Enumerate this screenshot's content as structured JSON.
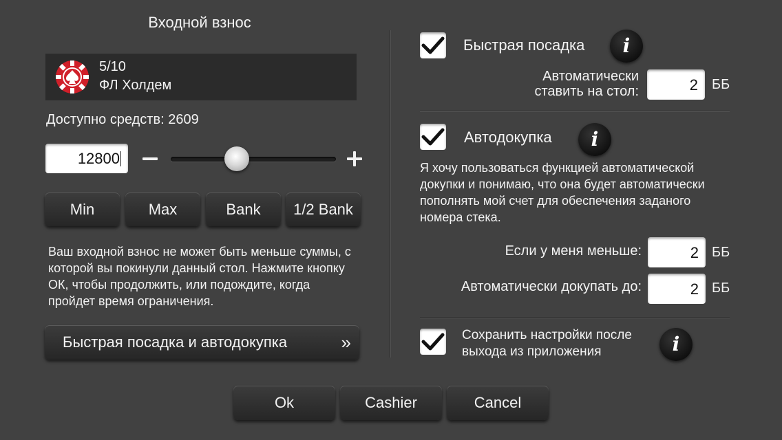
{
  "buyin": {
    "title": "Входной взнос",
    "table": {
      "stakes": "5/10",
      "game": "ФЛ Холдем"
    },
    "available_label": "Доступно средств: 2609",
    "amount_value": "12800",
    "minus_symbol": "−",
    "plus_symbol": "+",
    "slider_level": 0.4,
    "quick_buttons": [
      "Min",
      "Max",
      "Bank",
      "1/2 Bank"
    ],
    "notice": "Ваш входной взнос не может быть меньше суммы, с которой вы покинули данный стол. Нажмите кнопку ОК, чтобы продолжить, или подождите, когда пройдет время ограничения.",
    "fast_seat_button": "Быстрая посадка и автодокупка",
    "fast_seat_chevron": "»"
  },
  "settings": {
    "fast_seat": {
      "label": "Быстрая посадка",
      "checked": true,
      "auto_label_line1": "Автоматически",
      "auto_label_line2": "ставить на стол:",
      "value": "2",
      "unit": "ББ"
    },
    "auto_rebuy": {
      "label": "Автодокупка",
      "checked": true,
      "description": "Я хочу пользоваться функцией автоматической докупки и понимаю, что она будет автоматически пополнять мой счет для обеспечения заданого номера стека.",
      "if_less_label": "Если у меня меньше:",
      "if_less_value": "2",
      "rebuy_to_label": "Автоматически докупать до:",
      "rebuy_to_value": "2",
      "unit": "ББ"
    },
    "save_settings": {
      "label_line1": "Сохранить настройки после",
      "label_line2": "выхода из приложения",
      "checked": true
    },
    "info_glyph": "i"
  },
  "footer": {
    "ok": "Ok",
    "cashier": "Cashier",
    "cancel": "Cancel"
  },
  "colors": {
    "background": "#414141",
    "panel": "#2b2b2b",
    "chip_red": "#d0202a"
  }
}
